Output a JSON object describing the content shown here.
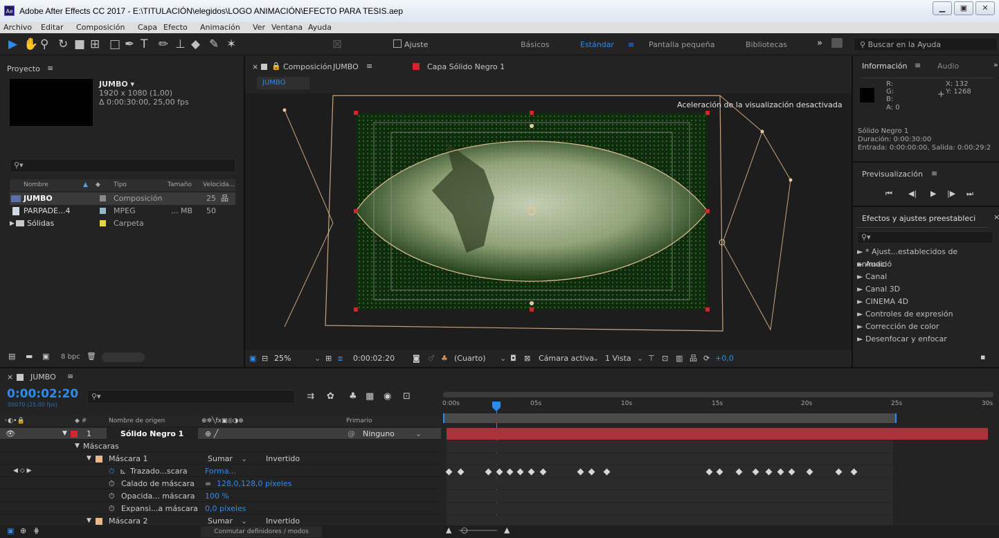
{
  "window": {
    "app_icon": "Ae",
    "title": "Adobe After Effects CC 2017 - E:\\TITULACIÓN\\elegidos\\LOGO ANIMACIÓN\\EFECTO PARA TESIS.aep"
  },
  "menu": [
    "Archivo",
    "Editar",
    "Composición",
    "Capa",
    "Efecto",
    "Animación",
    "Ver",
    "Ventana",
    "Ayuda"
  ],
  "toolbar": {
    "ajuste": "Ajuste",
    "workspaces": [
      "Básicos",
      "Estándar",
      "Pantalla pequeña",
      "Bibliotecas"
    ],
    "more": "»",
    "search_placeholder": "Buscar en la Ayuda"
  },
  "project": {
    "title": "Proyecto",
    "comp_name": "JUMBO ▾",
    "comp_size": "1920 x 1080 (1,00)",
    "comp_dur": "Δ 0:00:30:00, 25,00 fps",
    "columns": [
      "Nombre",
      "Tipo",
      "Tamaño",
      "Velocida..."
    ],
    "items": [
      {
        "name": "JUMBO",
        "type": "Composición",
        "size": "",
        "fps": "25",
        "color": "#8a8a8a"
      },
      {
        "name": "PARPADE...4",
        "type": "MPEG",
        "size": "... MB",
        "fps": "50",
        "color": "#8fb8c8"
      },
      {
        "name": "Sólidas",
        "type": "Carpeta",
        "size": "",
        "fps": "",
        "color": "#e8d44a"
      }
    ],
    "bpc": "8 bpc"
  },
  "comp": {
    "tab": "Composición",
    "tab_comp": "JUMBO",
    "layer_tab": "Capa Sólido Negro 1",
    "crumb": "JUMBO",
    "notice": "Aceleración de la visualización desactivada",
    "zoom": "25%",
    "time": "0:00:02:20",
    "resolution": "(Cuarto)",
    "camera": "Cámara activa",
    "views": "1 Vista",
    "exposure": "+0,0"
  },
  "info": {
    "tab_info": "Información",
    "tab_audio": "Audio",
    "r": "R:",
    "g": "G:",
    "b": "B:",
    "a": "A:  0",
    "x": "X: 132",
    "y": "Y: 1268",
    "layer": "Sólido Negro 1",
    "dur": "Duración: 0:00:30:00",
    "io": "Entrada: 0:00:00:00, Salida: 0:00:29:2"
  },
  "preview": {
    "title": "Previsualización"
  },
  "effects": {
    "title": "Efectos y ajustes preestableci",
    "items": [
      "► * Ajust...establecidos de animació",
      "► Audio",
      "► Canal",
      "► Canal 3D",
      "► CINEMA 4D",
      "► Controles de expresión",
      "► Corrección de color",
      "► Desenfocar y enfocar"
    ]
  },
  "timeline": {
    "tab": "JUMBO",
    "timecode": "0:00:02:20",
    "frames": "00070 (25.00 fps)",
    "col_source": "Nombre de origen",
    "col_parent": "Primario",
    "layer_num": "1",
    "layer_name": "Sólido Negro 1",
    "parent": "Ninguno",
    "masks": "Máscaras",
    "mask1": "Máscara 1",
    "mode": "Sumar",
    "inverted": "Invertido",
    "path": "Trazado...scara",
    "path_val": "Forma...",
    "feather": "Calado de máscara",
    "feather_val": "128,0,128,0 píxeles",
    "opacity": "Opacida... máscara",
    "opacity_val": "100 %",
    "expansion": "Expansi...a máscara",
    "expansion_val": "0,0 píxeles",
    "mask2": "Máscara 2",
    "toggle": "Conmutar definidores / modos",
    "ticks": [
      "0:00s",
      "05s",
      "10s",
      "15s",
      "20s",
      "25s",
      "30s"
    ]
  }
}
